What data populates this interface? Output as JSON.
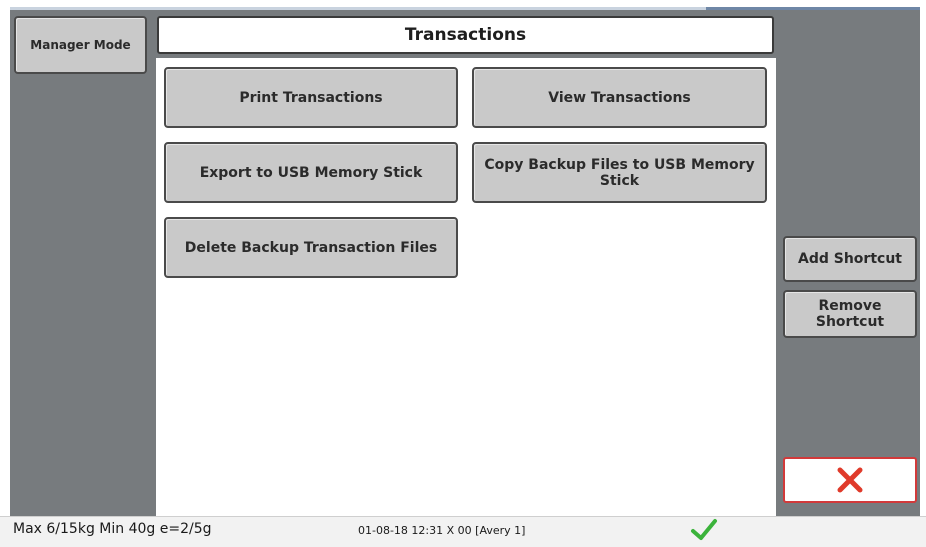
{
  "header": {
    "mode_button": "Manager Mode",
    "title": "Transactions"
  },
  "actions": [
    {
      "label": "Print Transactions"
    },
    {
      "label": "View Transactions"
    },
    {
      "label": "Export to USB Memory Stick"
    },
    {
      "label": "Copy Backup Files to USB Memory Stick"
    },
    {
      "label": "Delete Backup Transaction Files"
    }
  ],
  "shortcuts": {
    "add_label": "Add Shortcut",
    "remove_label": "Remove Shortcut"
  },
  "close": {
    "icon": "close-x-icon",
    "color": "#e03a2a"
  },
  "status": {
    "scale_spec": "Max 6/15kg Min 40g e=2/5g",
    "datetime": "01-08-18 12:31 X 00 [Avery 1]",
    "ok_icon": "checkmark-icon",
    "ok_color": "#3bb33b"
  }
}
